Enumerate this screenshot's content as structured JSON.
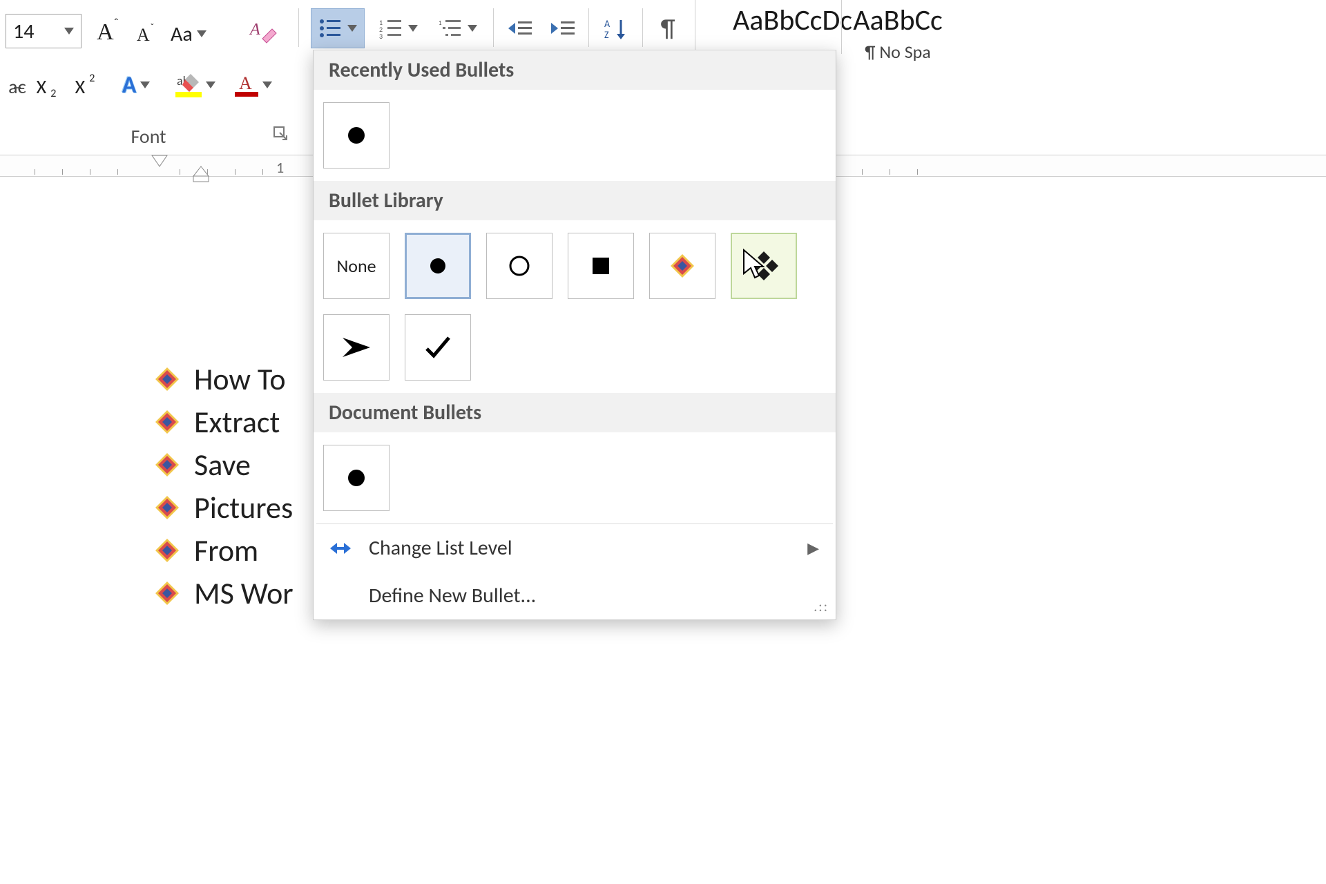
{
  "ribbon": {
    "font_size_value": "14",
    "group_label": "Font",
    "change_case_label": "Aa",
    "styles": {
      "preview_sample": "AaBbCcDc",
      "preview_sample2": "AaBbCc",
      "no_spacing_caption": "¶ No Spa"
    }
  },
  "ruler": {
    "mark_1": "1"
  },
  "doc_items": [
    "How To",
    "Extract",
    "Save",
    "Pictures",
    "From",
    "MS Wor"
  ],
  "bullets_panel": {
    "section_recent": "Recently Used Bullets",
    "section_library": "Bullet Library",
    "section_document": "Document Bullets",
    "none_label": "None",
    "change_level": "Change List Level",
    "define_new": "Define New Bullet..."
  }
}
